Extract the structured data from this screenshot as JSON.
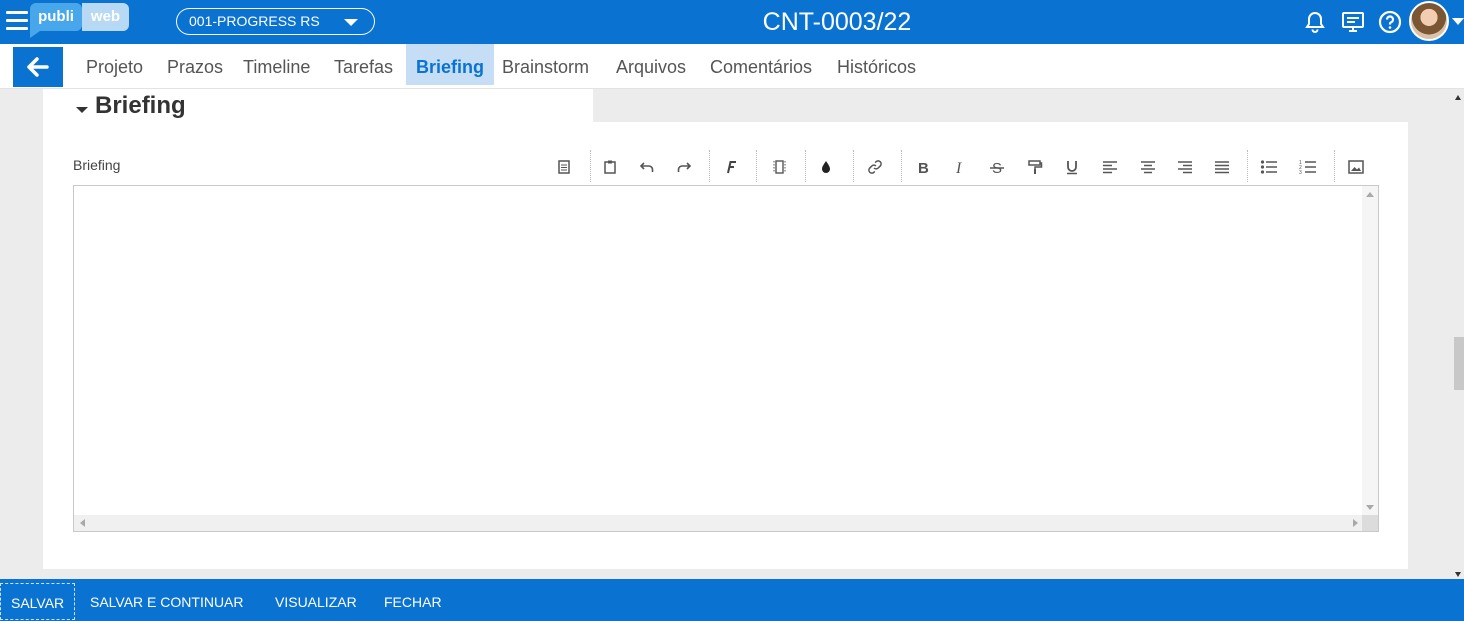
{
  "header": {
    "logo_left": "publi",
    "logo_right": "web",
    "client_selected": "001-PROGRESS RS",
    "title": "CNT-0003/22"
  },
  "tabs": [
    {
      "label": "Projeto"
    },
    {
      "label": "Prazos"
    },
    {
      "label": "Timeline"
    },
    {
      "label": "Tarefas"
    },
    {
      "label": "Briefing",
      "active": true
    },
    {
      "label": "Brainstorm"
    },
    {
      "label": "Arquivos"
    },
    {
      "label": "Comentários"
    },
    {
      "label": "Históricos"
    }
  ],
  "section": {
    "title": "Briefing",
    "field_label": "Briefing",
    "editor_value": ""
  },
  "toolbar_icons": [
    "source-icon",
    "paste-icon",
    "undo-icon",
    "redo-icon",
    "font-icon",
    "html-block-icon",
    "color-icon",
    "link-icon",
    "bold-icon",
    "italic-icon",
    "strikethrough-icon",
    "format-painter-icon",
    "underline-icon",
    "align-left-icon",
    "align-center-icon",
    "align-right-icon",
    "justify-icon",
    "bullet-list-icon",
    "numbered-list-icon",
    "image-icon"
  ],
  "footer": {
    "save": "SALVAR",
    "save_continue": "SALVAR E CONTINUAR",
    "preview": "VISUALIZAR",
    "close": "FECHAR"
  },
  "colors": {
    "primary": "#0a73d1",
    "tab_active_bg": "#c5def5"
  }
}
